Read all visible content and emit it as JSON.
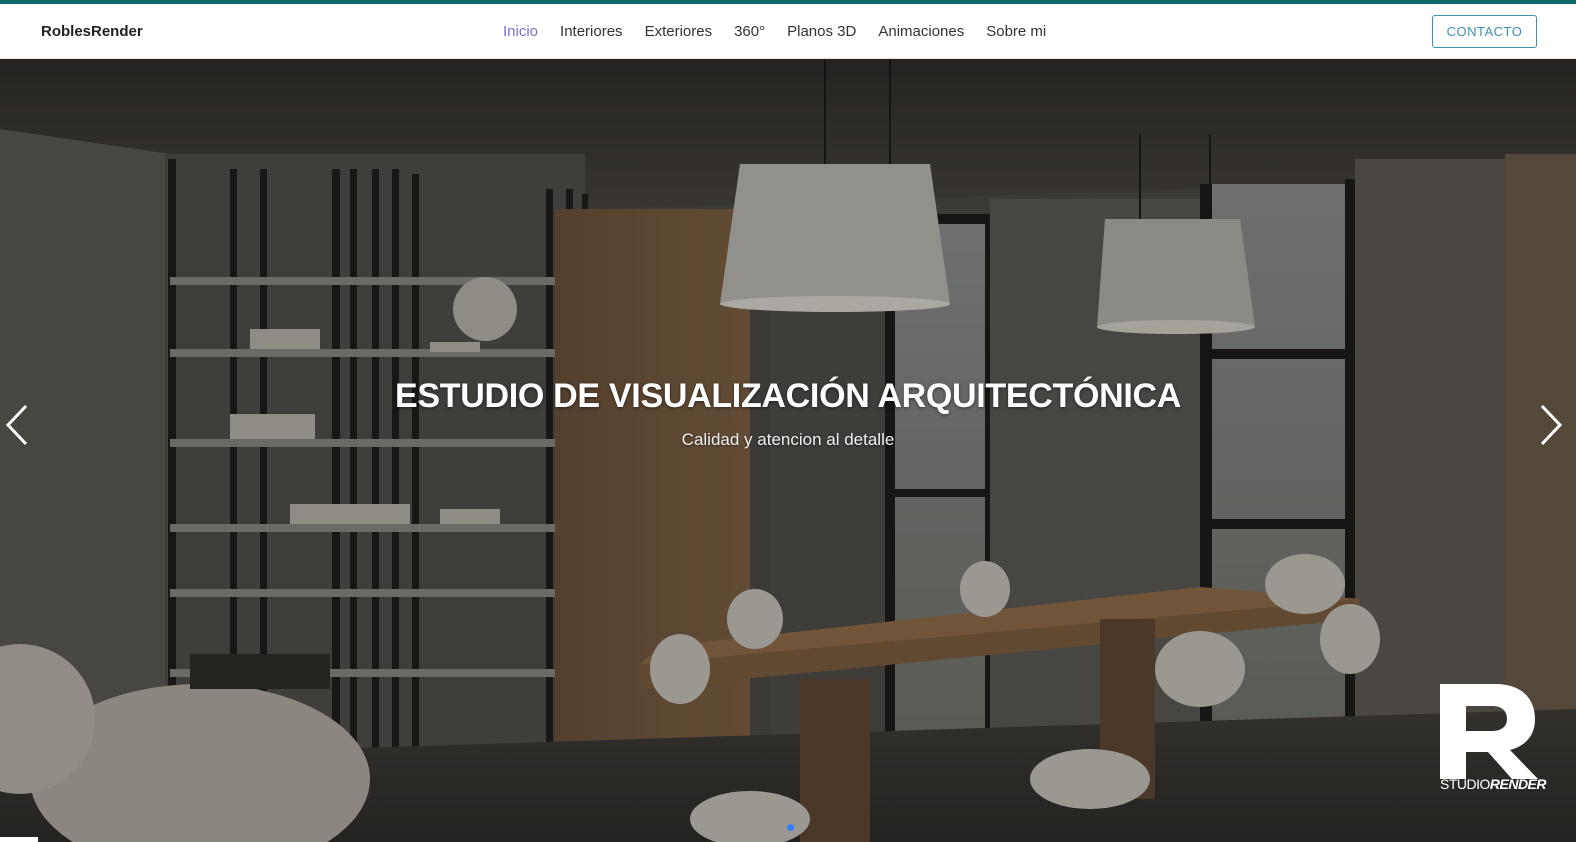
{
  "nav": {
    "brand": "RoblesRender",
    "links": [
      {
        "label": "Inicio",
        "active": true
      },
      {
        "label": "Interiores",
        "active": false
      },
      {
        "label": "Exteriores",
        "active": false
      },
      {
        "label": "360°",
        "active": false
      },
      {
        "label": "Planos 3D",
        "active": false
      },
      {
        "label": "Animaciones",
        "active": false
      },
      {
        "label": "Sobre mi",
        "active": false
      }
    ],
    "contact_button": "CONTACTO"
  },
  "hero": {
    "title": "ESTUDIO DE VISUALIZACIÓN ARQUITECTÓNICA",
    "subtitle": "Calidad y atencion al detalle",
    "prev_icon": "chevron-left-icon",
    "next_icon": "chevron-right-icon",
    "indicator_count": 1,
    "active_slide": 1
  },
  "logo": {
    "letter": "R",
    "studio": "STUDIO",
    "render": "RENDER"
  },
  "colors": {
    "accent_top": "#0f6b6b",
    "nav_active": "#7a6fd1",
    "contact_border": "#3f8fb0",
    "indicator": "#2d7ff9"
  }
}
